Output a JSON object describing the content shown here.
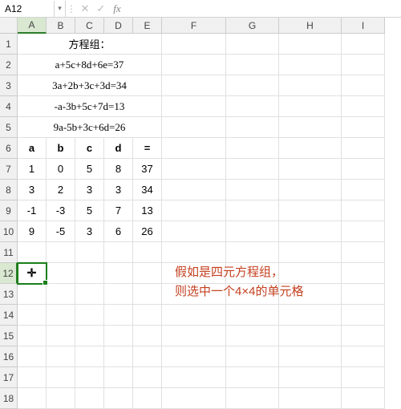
{
  "namebox": {
    "value": "A12"
  },
  "columns": [
    {
      "label": "A",
      "width": 36,
      "active": true
    },
    {
      "label": "B",
      "width": 36
    },
    {
      "label": "C",
      "width": 36
    },
    {
      "label": "D",
      "width": 36
    },
    {
      "label": "E",
      "width": 36
    },
    {
      "label": "F",
      "width": 80
    },
    {
      "label": "G",
      "width": 66
    },
    {
      "label": "H",
      "width": 78
    },
    {
      "label": "I",
      "width": 54
    }
  ],
  "rows": [
    {
      "n": "1"
    },
    {
      "n": "2"
    },
    {
      "n": "3"
    },
    {
      "n": "4"
    },
    {
      "n": "5"
    },
    {
      "n": "6"
    },
    {
      "n": "7"
    },
    {
      "n": "8"
    },
    {
      "n": "9"
    },
    {
      "n": "10"
    },
    {
      "n": "11"
    },
    {
      "n": "12",
      "active": true
    },
    {
      "n": "13"
    },
    {
      "n": "14"
    },
    {
      "n": "15"
    },
    {
      "n": "16"
    },
    {
      "n": "17"
    },
    {
      "n": "18"
    }
  ],
  "title_row": "方程组：",
  "equations": [
    "a+5c+8d+6e=37",
    "3a+2b+3c+3d=34",
    "-a-3b+5c+7d=13",
    "9a-5b+3c+6d=26"
  ],
  "header": {
    "a": "a",
    "b": "b",
    "c": "c",
    "d": "d",
    "eq": "="
  },
  "matrix": [
    {
      "a": "1",
      "b": "0",
      "c": "5",
      "d": "8",
      "eq": "37"
    },
    {
      "a": "3",
      "b": "2",
      "c": "3",
      "d": "3",
      "eq": "34"
    },
    {
      "a": "-1",
      "b": "-3",
      "c": "5",
      "d": "7",
      "eq": "13"
    },
    {
      "a": "9",
      "b": "-5",
      "c": "3",
      "d": "6",
      "eq": "26"
    }
  ],
  "cursor_glyph": "✛",
  "annotation": {
    "line1": "假如是四元方程组，",
    "line2": "则选中一个4×4的单元格"
  }
}
